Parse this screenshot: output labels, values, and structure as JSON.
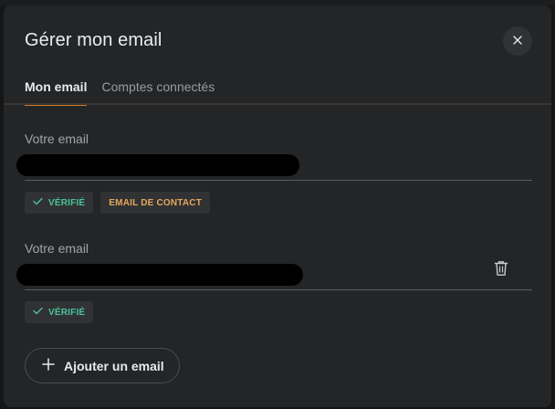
{
  "modal": {
    "title": "Gérer mon email",
    "close_icon": "close-icon"
  },
  "tabs": [
    {
      "label": "Mon email",
      "active": true
    },
    {
      "label": "Comptes connectés",
      "active": false
    }
  ],
  "emails": [
    {
      "label": "Votre email",
      "value": "",
      "redacted": true,
      "badges": [
        {
          "label": "VÉRIFIÉ",
          "icon": "check-icon",
          "color": "#4cc39a"
        },
        {
          "label": "EMAIL DE CONTACT",
          "color": "#e6a85a"
        }
      ],
      "deletable": false
    },
    {
      "label": "Votre email",
      "value": "",
      "redacted": true,
      "badges": [
        {
          "label": "VÉRIFIÉ",
          "icon": "check-icon",
          "color": "#4cc39a"
        }
      ],
      "deletable": true,
      "delete_icon": "trash-icon"
    }
  ],
  "add_button": {
    "label": "Ajouter un email",
    "icon": "plus-icon"
  },
  "colors": {
    "accent": "#d0772c",
    "verified": "#4cc39a",
    "contact": "#e6a85a",
    "background": "#232526"
  }
}
